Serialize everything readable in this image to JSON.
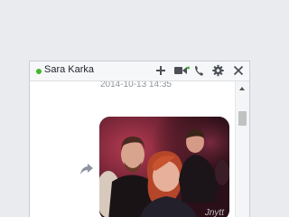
{
  "chat": {
    "contact_name": "Sara Karka",
    "status": "online",
    "timestamp": "2014-10-13 14:35",
    "photo_watermark": "Jnytt",
    "accent_online": "#42b72a",
    "header_icons": [
      "add-icon",
      "video-call-icon",
      "phone-icon",
      "settings-icon",
      "close-icon"
    ]
  }
}
